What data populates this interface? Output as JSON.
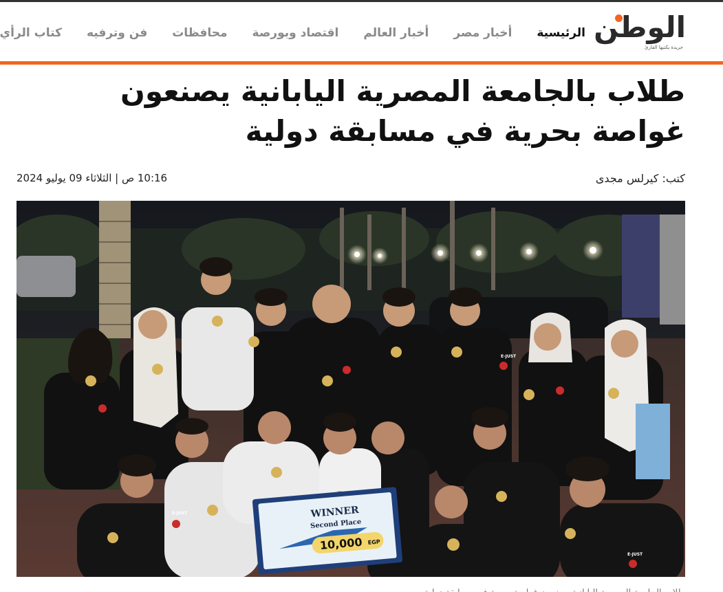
{
  "site": {
    "logo_text": "الوطن",
    "logo_tagline": "جريدة يكتبها القارئ",
    "brand_color": "#f26522"
  },
  "nav": {
    "items": [
      {
        "label": "الرئيسية",
        "active": true
      },
      {
        "label": "أخبار مصر",
        "active": false
      },
      {
        "label": "أخبار العالم",
        "active": false
      },
      {
        "label": "اقتصاد وبورصة",
        "active": false
      },
      {
        "label": "محافظات",
        "active": false
      },
      {
        "label": "فن وترفيه",
        "active": false
      },
      {
        "label": "كتاب الرأي",
        "active": false
      }
    ]
  },
  "article": {
    "title": "طلاب بالجامعة المصرية اليابانية يصنعون غواصة بحرية في مسابقة دولية",
    "author": "كتب: كيرلس مجدى",
    "date": "10:16 ص | الثلاثاء 09 يوليو 2024",
    "photo": {
      "shirt_badge": "E-JUST",
      "sign": {
        "title": "WINNER",
        "subtitle": "Second Place",
        "prize": "10,000",
        "currency": "EGP"
      }
    },
    "caption": "طلاب الجامعة المصرية اليابانية يصنعون غواصة بحرية في مسابقة دولية"
  }
}
